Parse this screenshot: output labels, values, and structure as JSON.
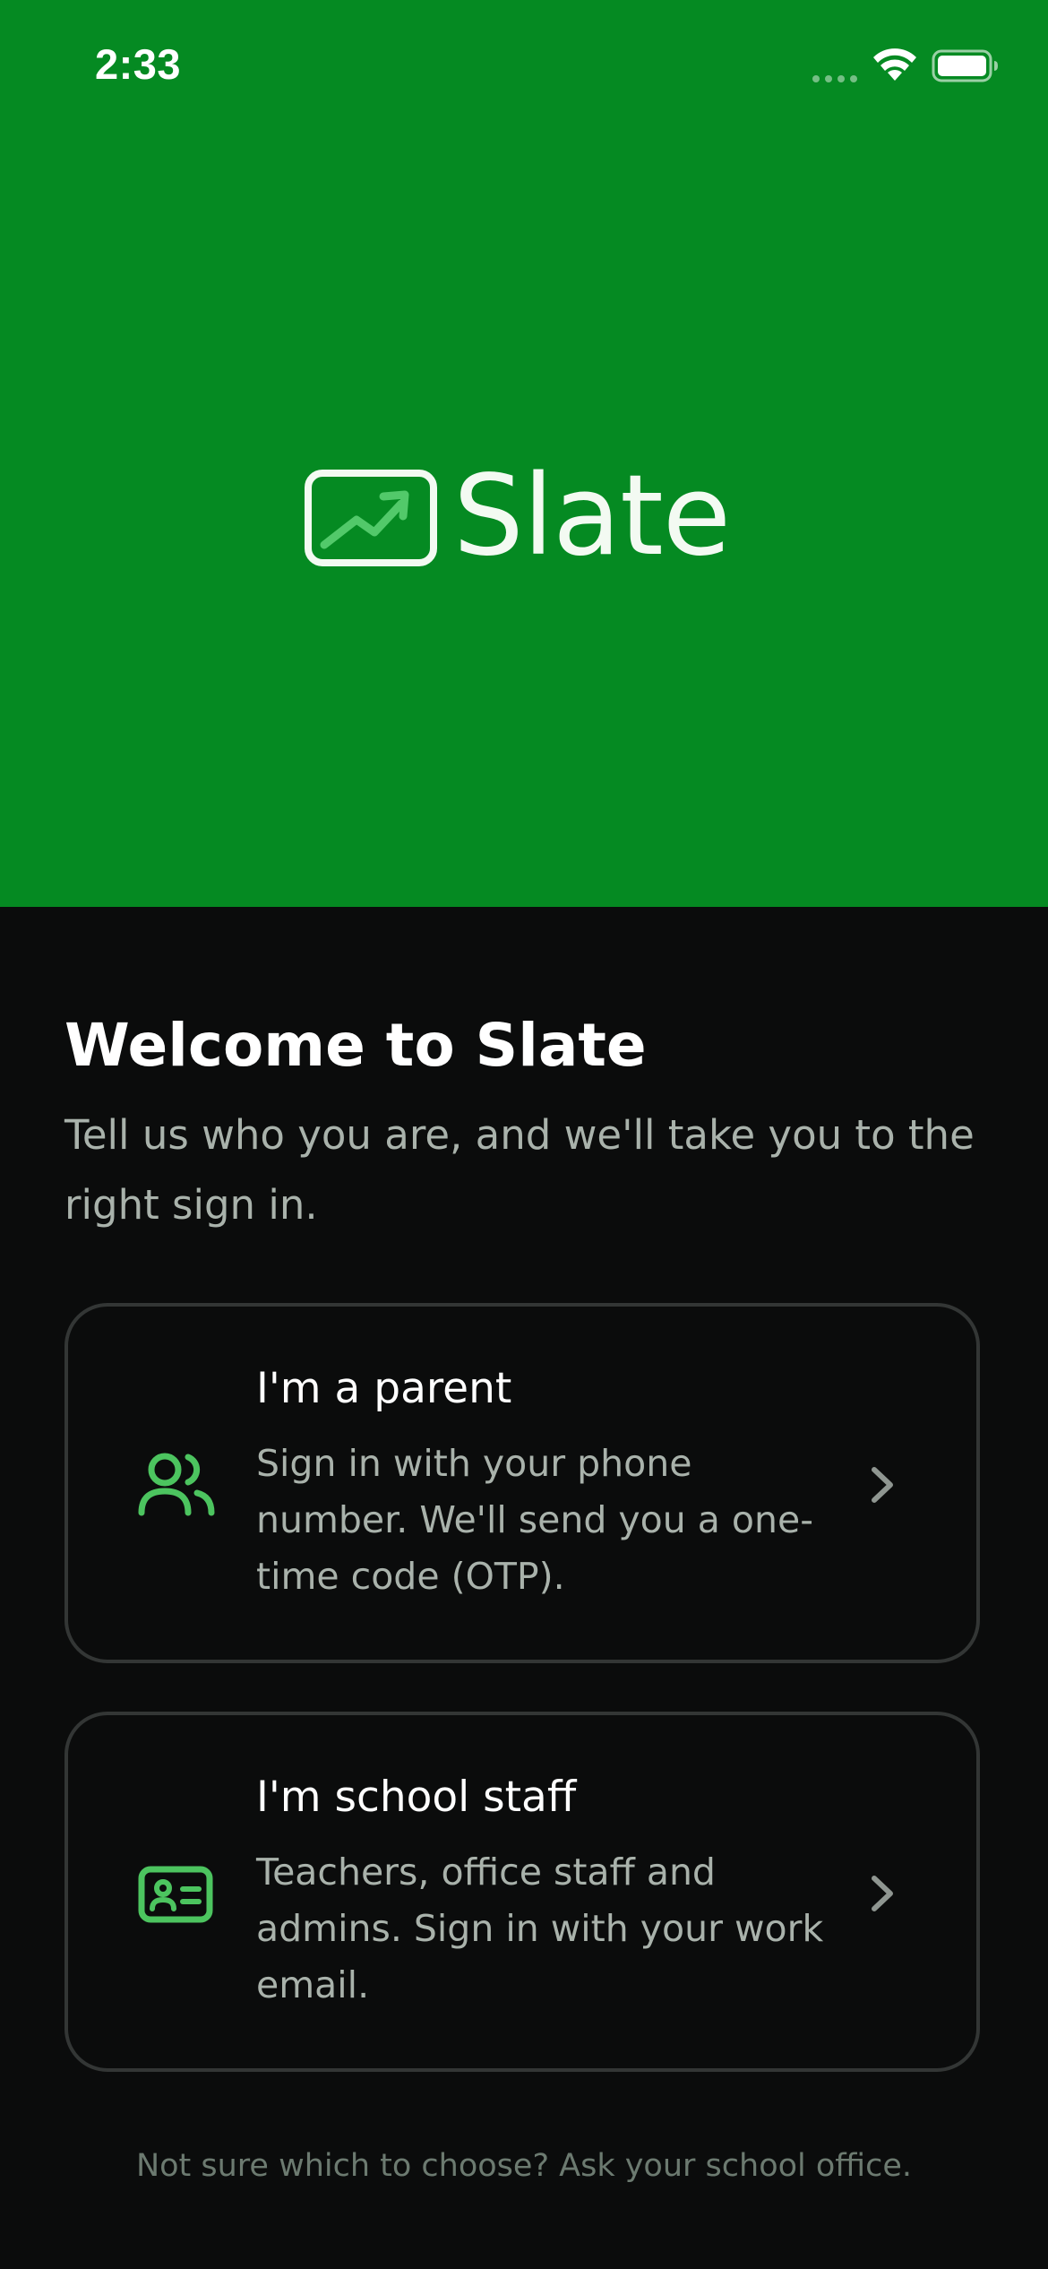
{
  "status_bar": {
    "time": "2:33",
    "signal_icon": "cellular-signal-icon",
    "wifi_icon": "wifi-icon",
    "battery_icon": "battery-full-icon"
  },
  "brand": {
    "logo_icon": "trending-chart-board-icon",
    "name": "Slate",
    "color": "#058a22",
    "accent": "#3fbf5a"
  },
  "welcome": {
    "title": "Welcome to Slate",
    "subtitle": "Tell us who you are, and we'll take you to the right sign in."
  },
  "roles": [
    {
      "icon": "users-icon",
      "title": "I'm a parent",
      "description": "Sign in with your phone number. We'll send you a one-time code (OTP).",
      "chevron": "chevron-right-icon"
    },
    {
      "icon": "id-card-icon",
      "title": "I'm school staff",
      "description": "Teachers, office staff and admins. Sign in with your work email.",
      "chevron": "chevron-right-icon"
    }
  ],
  "footer": {
    "hint": "Not sure which to choose? Ask your school office."
  }
}
